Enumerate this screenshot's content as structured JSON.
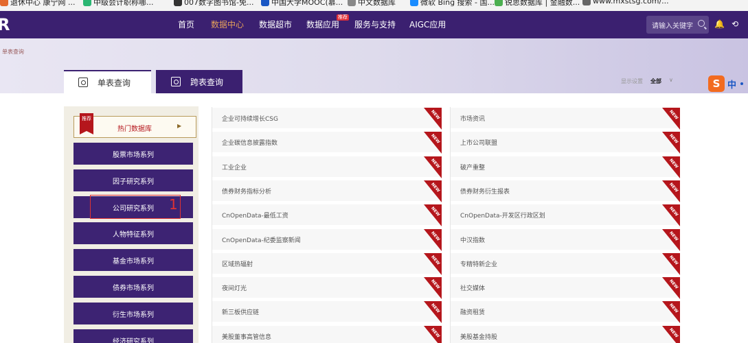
{
  "bookmarks": [
    {
      "label": "退休中心 康宁网 ...",
      "color": "#e46a2d"
    },
    {
      "label": "中级会计职称哪...",
      "color": "#2bb673"
    },
    {
      "label": "007数字图书馆-免...",
      "color": "#333333"
    },
    {
      "label": "中国大学MOOC(慕...",
      "color": "#1a57c4"
    },
    {
      "label": "中文数据库",
      "color": "#888888"
    },
    {
      "label": "微软 Bing 搜索 - 国...",
      "color": "#1a8cff"
    },
    {
      "label": "锐思数据库 | 金融数...",
      "color": "#4caf50"
    },
    {
      "label": "www.mxstsg.com/...",
      "color": "#666666"
    }
  ],
  "nav": {
    "logo": "R",
    "items": [
      "首页",
      "数据中心",
      "数据超市",
      "数据应用",
      "服务与支持",
      "AIGC应用"
    ],
    "active_index": 1,
    "badge": "推荐",
    "search_placeholder": "请输入关键字",
    "bell_icon": "🔔",
    "history_icon": "⟲",
    "colors": {
      "bar": "#3b2070",
      "active": "#e6a15a"
    }
  },
  "breadcrumb": "单表查询",
  "tabs": [
    {
      "label": "单表查询",
      "icon": "search-doc-icon"
    },
    {
      "label": "跨表查询",
      "icon": "search-doc-icon"
    }
  ],
  "display": {
    "label": "显示设置",
    "value": "全部",
    "chevron": "∨"
  },
  "ime": {
    "logo": "S",
    "mode": "中"
  },
  "sidebar": {
    "hot": {
      "tag": "推荐",
      "label": "热门数据库",
      "arrow": "▶"
    },
    "series": [
      "股票市场系列",
      "因子研究系列",
      "公司研究系列",
      "人物特征系列",
      "基金市场系列",
      "债券市场系列",
      "衍生市场系列",
      "经济研究系列"
    ],
    "annotation": "1"
  },
  "new_label": "NEW",
  "datasets_left": [
    "企业可持续增长CSG",
    "企业碳信息披露指数",
    "工业企业",
    "债券财务指标分析",
    "CnOpenData-最低工资",
    "CnOpenData-纪委监察新闻",
    "区域热辐射",
    "夜间灯光",
    "新三板供应链",
    "美股董事高管信息"
  ],
  "datasets_right": [
    "市场资讯",
    "上市公司联盟",
    "破产重整",
    "债券财务衍生报表",
    "CnOpenData-开发区行政区划",
    "中汉指数",
    "专精特新企业",
    "社交媒体",
    "融资租赁",
    "美股基金持股"
  ]
}
